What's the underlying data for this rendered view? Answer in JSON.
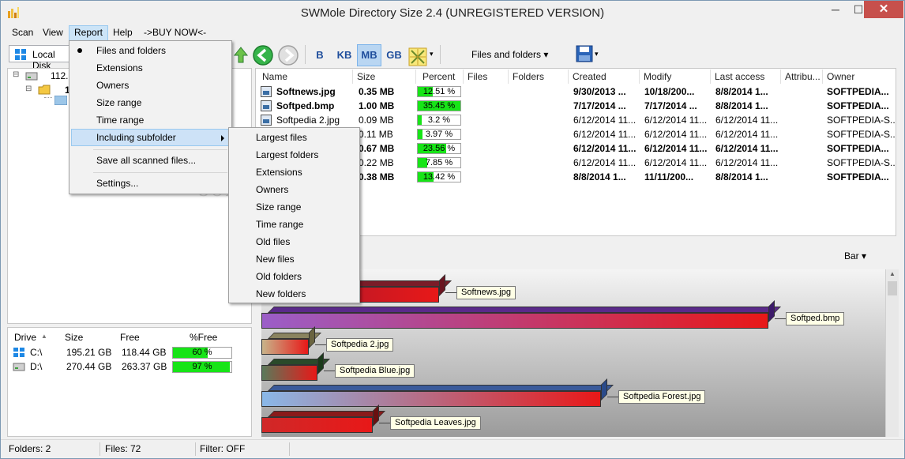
{
  "window": {
    "title": "SWMole Directory Size 2.4 (UNREGISTERED VERSION)",
    "min_glyph": "─",
    "max_glyph": "☐",
    "close_glyph": "✕"
  },
  "menubar": {
    "items": [
      {
        "label": "Scan"
      },
      {
        "label": "View"
      },
      {
        "label": "Report"
      },
      {
        "label": "Help"
      },
      {
        "label": "->BUY NOW<-"
      }
    ]
  },
  "toolbar": {
    "drive_selector": "Local Disk",
    "units": [
      "B",
      "KB",
      "MB",
      "GB"
    ],
    "selected_unit": "MB",
    "view_mode": "Files and folders ▾",
    "dropdown_arrow": "▾"
  },
  "tree": {
    "items": [
      {
        "label": "112.0",
        "icon": "drive-icon"
      },
      {
        "label": "1",
        "icon": "folder-icon"
      }
    ]
  },
  "drives": {
    "headers": [
      "Drive",
      "Size",
      "Free",
      "%Free"
    ],
    "rows": [
      {
        "drive": "C:\\",
        "size": "195.21 GB",
        "free": "118.44 GB",
        "pct_free": "60 %",
        "pct_value": 60
      },
      {
        "drive": "D:\\",
        "size": "270.44 GB",
        "free": "263.37 GB",
        "pct_free": "97 %",
        "pct_value": 97
      }
    ],
    "sort_arrow": "▲"
  },
  "file_list": {
    "headers": [
      "Name",
      "Size",
      "Percent",
      "Files",
      "Folders",
      "Created",
      "Modify",
      "Last access",
      "Attribu...",
      "Owner"
    ],
    "rows": [
      {
        "name": "Softnews.jpg",
        "size": "0.35 MB",
        "percent": "12.51 %",
        "pct": 12.51,
        "created": "9/30/2013 ...",
        "modify": "10/18/200...",
        "access": "8/8/2014 1...",
        "owner": "SOFTPEDIA...",
        "bold": true
      },
      {
        "name": "Softped.bmp",
        "size": "1.00 MB",
        "percent": "35.45 %",
        "pct": 35.45,
        "created": "7/17/2014 ...",
        "modify": "7/17/2014 ...",
        "access": "8/8/2014 1...",
        "owner": "SOFTPEDIA...",
        "bold": true
      },
      {
        "name": "Softpedia 2.jpg",
        "size": "0.09 MB",
        "percent": "3.2 %",
        "pct": 3.2,
        "created": "6/12/2014 11...",
        "modify": "6/12/2014 11...",
        "access": "6/12/2014 11...",
        "owner": "SOFTPEDIA-S...",
        "bold": false
      },
      {
        "name": "Softpedia Blue.jpg",
        "size": "0.11 MB",
        "percent": "3.97 %",
        "pct": 3.97,
        "created": "6/12/2014 11...",
        "modify": "6/12/2014 11...",
        "access": "6/12/2014 11...",
        "owner": "SOFTPEDIA-S...",
        "bold": false
      },
      {
        "name": "Softpedia Forest.jpg",
        "size": "0.67 MB",
        "percent": "23.56 %",
        "pct": 23.56,
        "created": "6/12/2014 11...",
        "modify": "6/12/2014 11...",
        "access": "6/12/2014 11...",
        "owner": "SOFTPEDIA...",
        "bold": true
      },
      {
        "name": "Softpedia Leaves.jpg",
        "size": "0.22 MB",
        "percent": "7.85 %",
        "pct": 7.85,
        "created": "6/12/2014 11...",
        "modify": "6/12/2014 11...",
        "access": "6/12/2014 11...",
        "owner": "SOFTPEDIA-S...",
        "bold": false
      },
      {
        "name": "Softpedia.jpg",
        "size": "0.38 MB",
        "percent": "13.42 %",
        "pct": 13.42,
        "created": "8/8/2014 1...",
        "modify": "11/11/200...",
        "access": "8/8/2014 1...",
        "owner": "SOFTPEDIA...",
        "bold": true
      }
    ]
  },
  "chart": {
    "mode_label": "Bar ▾",
    "bars": [
      {
        "label": "Softnews.jpg",
        "value": 0.35,
        "face": "#e81818",
        "top": "#7a1c28",
        "side": "#6a1420",
        "grad": "#a01830"
      },
      {
        "label": "Softped.bmp",
        "value": 1.0,
        "face": "#e81818",
        "top": "#5a2a8a",
        "side": "#3c1a6a",
        "grad": "#9b5ec8"
      },
      {
        "label": "Softpedia 2.jpg",
        "value": 0.09,
        "face": "#e81818",
        "top": "#8a8460",
        "side": "#6a6440",
        "grad": "#c8b48a"
      },
      {
        "label": "Softpedia Blue.jpg",
        "value": 0.11,
        "face": "#e81818",
        "top": "#2a4a2a",
        "side": "#1a3a1a",
        "grad": "#5a7a5a"
      },
      {
        "label": "Softpedia Forest.jpg",
        "value": 0.67,
        "face": "#e81818",
        "top": "#3a5a9a",
        "side": "#2a4a8a",
        "grad": "#8ab8e8"
      },
      {
        "label": "Softpedia Leaves.jpg",
        "value": 0.22,
        "face": "#e81818",
        "top": "#8a1a1a",
        "side": "#6a1010",
        "grad": "#d02828"
      }
    ]
  },
  "report_menu": {
    "items": [
      {
        "label": "Files and folders",
        "checked": true
      },
      {
        "label": "Extensions"
      },
      {
        "label": "Owners"
      },
      {
        "label": "Size range"
      },
      {
        "label": "Time range"
      },
      {
        "label": "Including subfolder",
        "submenu": true
      },
      {
        "label": "Save all scanned files..."
      },
      {
        "label": "Settings..."
      }
    ]
  },
  "submenu": {
    "items": [
      {
        "label": "Largest files"
      },
      {
        "label": "Largest folders"
      },
      {
        "label": "Extensions"
      },
      {
        "label": "Owners"
      },
      {
        "label": "Size range"
      },
      {
        "label": "Time range"
      },
      {
        "label": "Old files"
      },
      {
        "label": "New files"
      },
      {
        "label": "Old folders"
      },
      {
        "label": "New folders"
      }
    ]
  },
  "status": {
    "folders": "Folders: 2",
    "files": "Files: 72",
    "filter": "Filter: OFF"
  },
  "watermark": "SOFTPEDIA"
}
